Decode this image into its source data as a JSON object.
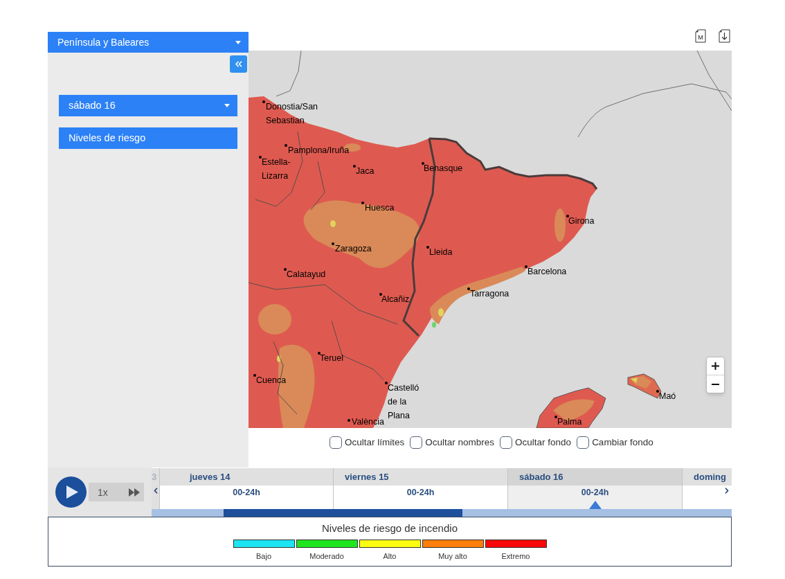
{
  "region_selector": {
    "value": "Península y Baleares"
  },
  "panel": {
    "day_selector": {
      "value": "sábado 16"
    },
    "layer_button": {
      "label": "Niveles de riesgo"
    }
  },
  "toolbar": [
    {
      "kind": "document",
      "letter": "M"
    },
    {
      "kind": "download"
    }
  ],
  "map": {
    "cities": [
      {
        "name": "Donostia/San Sebastian"
      },
      {
        "name": "Pamplona/Iruña"
      },
      {
        "name": "Estella-Lizarra"
      },
      {
        "name": "Jaca"
      },
      {
        "name": "Benasque"
      },
      {
        "name": "Huesca"
      },
      {
        "name": "Girona"
      },
      {
        "name": "Zaragoza"
      },
      {
        "name": "Lleida"
      },
      {
        "name": "Barcelona"
      },
      {
        "name": "Calatayud"
      },
      {
        "name": "Tarragona"
      },
      {
        "name": "Alcañiz"
      },
      {
        "name": "Teruel"
      },
      {
        "name": "Cuenca"
      },
      {
        "name": "Castelló de la Plana"
      },
      {
        "name": "València"
      },
      {
        "name": "Maó"
      },
      {
        "name": "Palma"
      }
    ]
  },
  "map_options": [
    {
      "label": "Ocultar límites",
      "checked": false
    },
    {
      "label": "Ocultar nombres",
      "checked": false
    },
    {
      "label": "Ocultar fondo",
      "checked": false
    },
    {
      "label": "Cambiar fondo",
      "checked": false
    }
  ],
  "playback": {
    "playing": false,
    "speed": "1x"
  },
  "timeline": {
    "days": [
      {
        "label": "3",
        "selected": false
      },
      {
        "label": "jueves 14",
        "slot": "00-24h",
        "selected": false
      },
      {
        "label": "viernes 15",
        "slot": "00-24h",
        "selected": false
      },
      {
        "label": "sábado 16",
        "slot": "00-24h",
        "selected": true
      },
      {
        "label": "doming",
        "selected": false
      }
    ]
  },
  "legend": {
    "title": "Niveles de riesgo de incendio",
    "levels": [
      {
        "label": "Bajo",
        "color": "#1de4f2"
      },
      {
        "label": "Moderado",
        "color": "#1fe51f"
      },
      {
        "label": "Alto",
        "color": "#fdfd12"
      },
      {
        "label": "Muy alto",
        "color": "#fd7e0a"
      },
      {
        "label": "Extremo",
        "color": "#f80808"
      }
    ]
  }
}
